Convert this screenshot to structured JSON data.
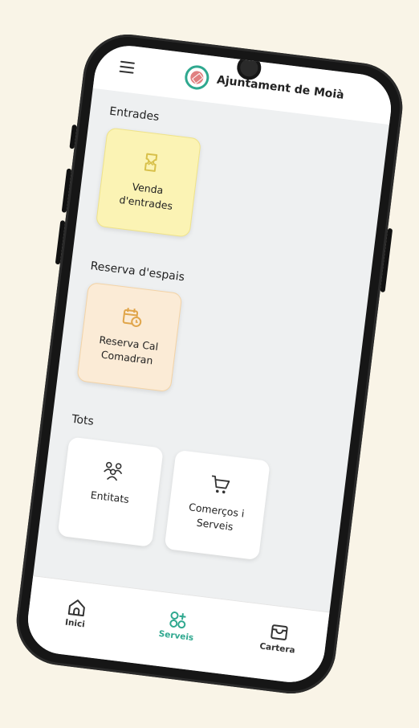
{
  "header": {
    "title": "Ajuntament de Moià",
    "menu_icon": "hamburger-menu-icon",
    "logo_icon": "town-crest-icon"
  },
  "sections": {
    "tickets": {
      "title": "Entrades",
      "card": {
        "label": "Venda d'entrades",
        "icon": "ticket-icon"
      }
    },
    "spaces": {
      "title": "Reserva d'espais",
      "card": {
        "label": "Reserva Cal Comadran",
        "icon": "calendar-clock-icon"
      }
    },
    "all": {
      "title": "Tots",
      "cards": [
        {
          "label": "Entitats",
          "icon": "people-group-icon"
        },
        {
          "label": "Comerços i Serveis",
          "icon": "shopping-cart-icon"
        }
      ]
    }
  },
  "bottom_nav": {
    "items": [
      {
        "label": "Inici",
        "icon": "home-icon"
      },
      {
        "label": "Serveis",
        "icon": "services-grid-icon",
        "active": true
      },
      {
        "label": "Cartera",
        "icon": "wallet-icon"
      }
    ]
  },
  "colors": {
    "background": "#f9f4e7",
    "accent": "#2fa88f",
    "ticket_card": "#fbf3b4",
    "ticket_icon": "#d8c04a",
    "space_card": "#fbebd6",
    "space_icon": "#e0a54a"
  }
}
